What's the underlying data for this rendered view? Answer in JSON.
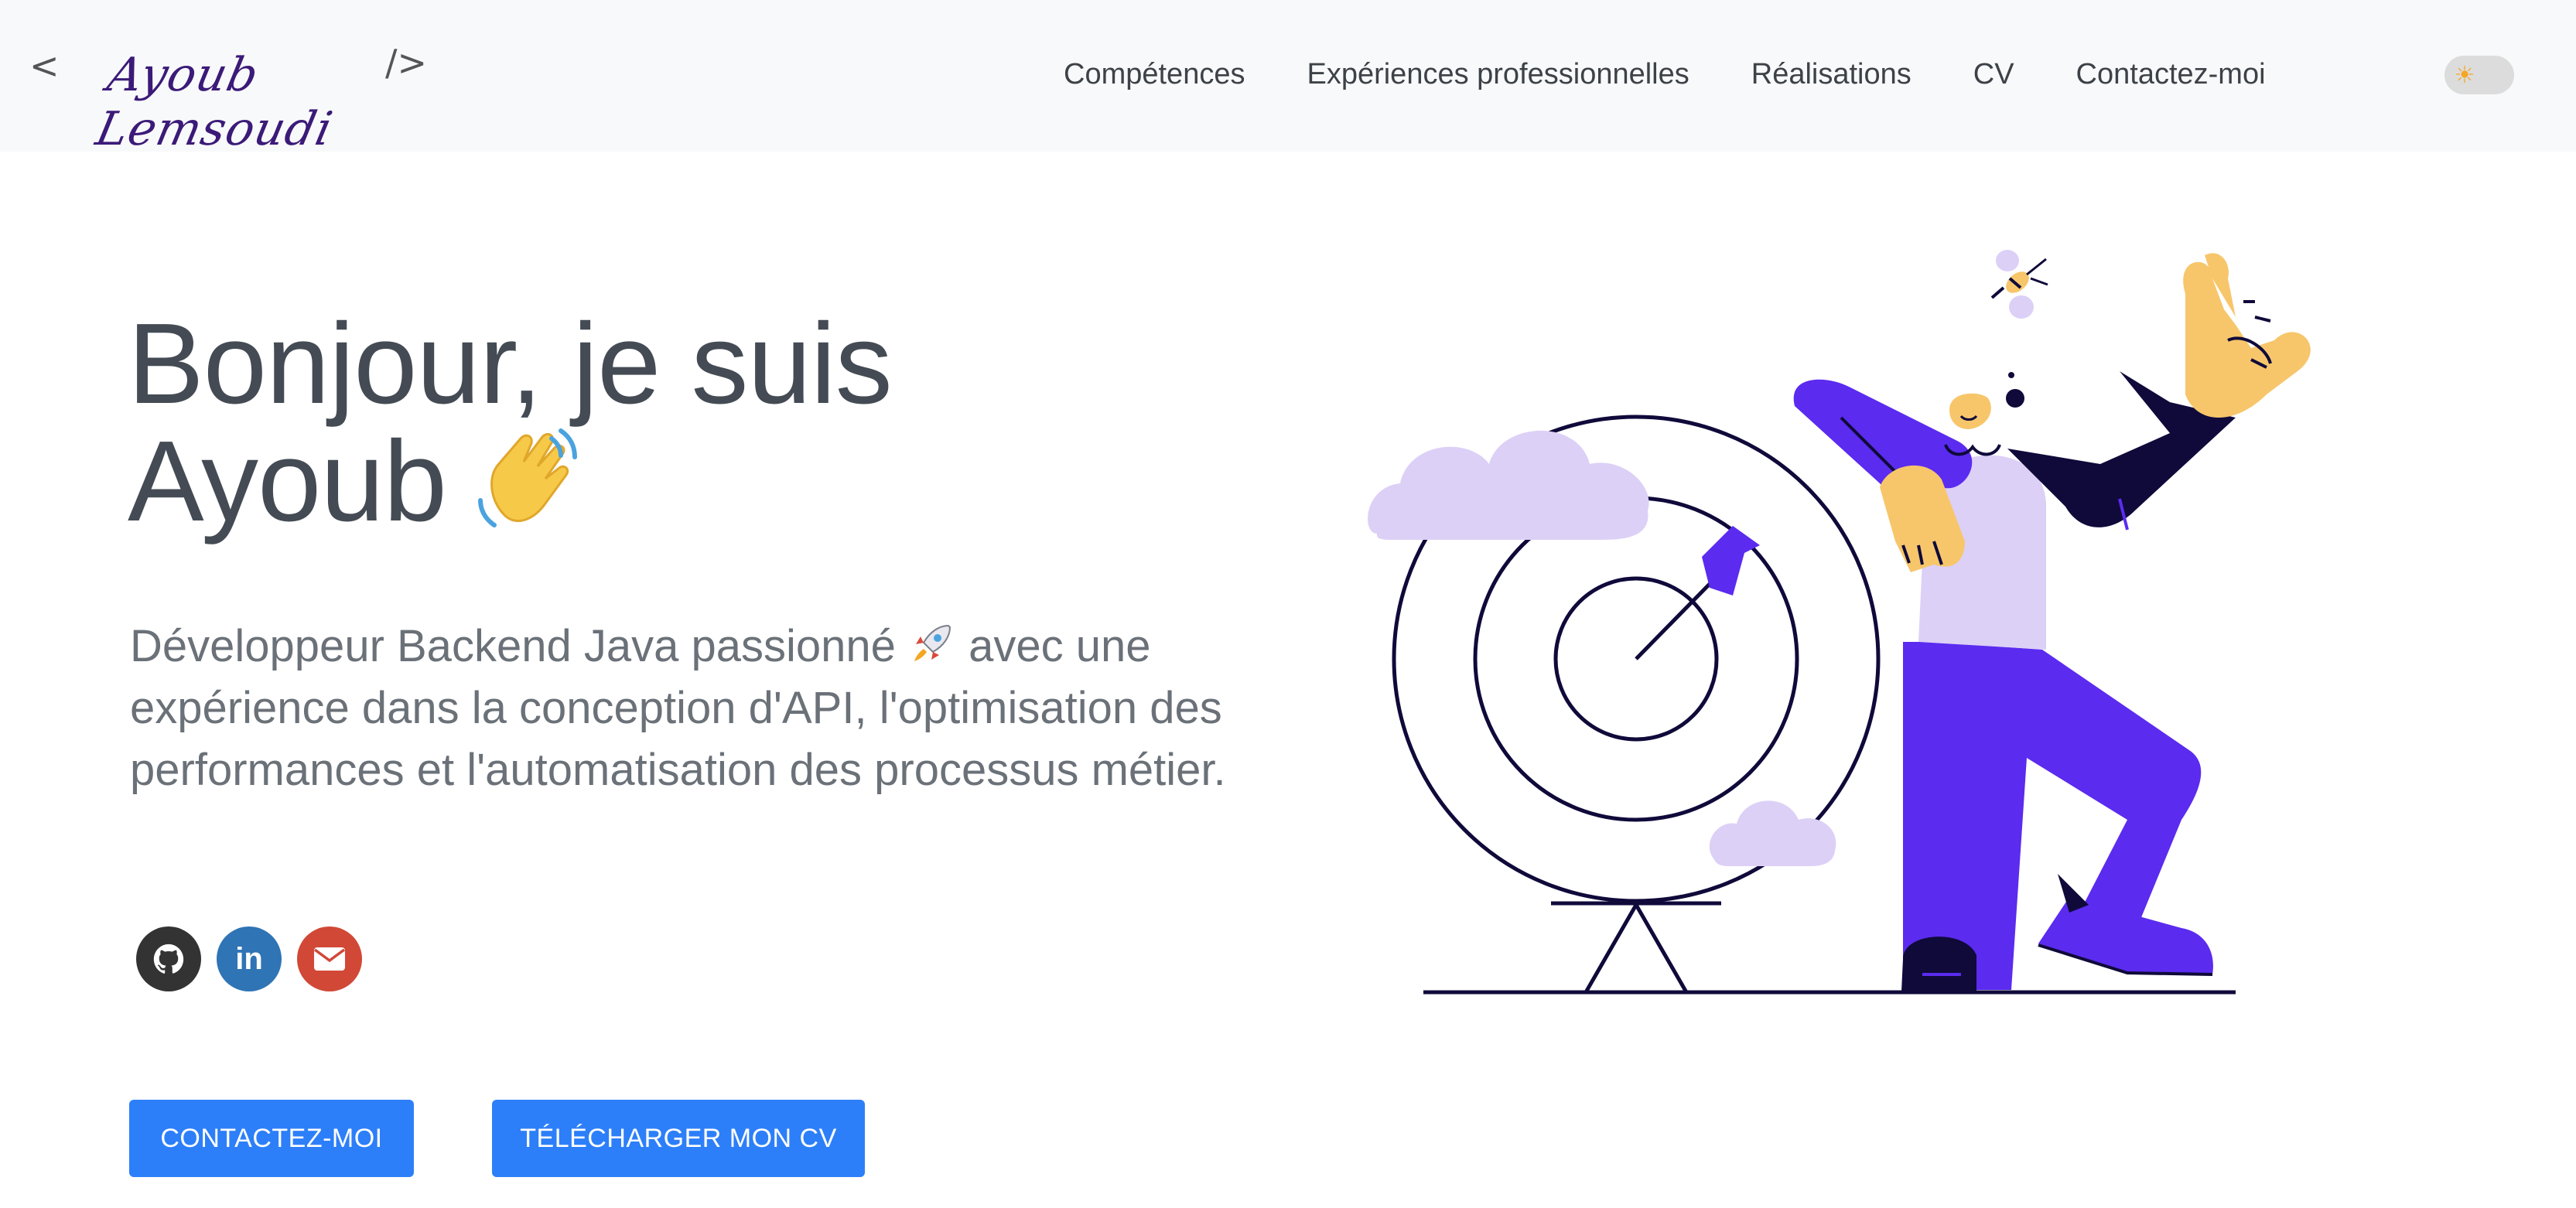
{
  "header": {
    "logo": {
      "bracket_open": "<",
      "bracket_close": "/>",
      "signature": "Ayoub Lemsoudi"
    },
    "nav": [
      {
        "label": "Compétences"
      },
      {
        "label": "Expériences professionnelles"
      },
      {
        "label": "Réalisations"
      },
      {
        "label": "CV"
      },
      {
        "label": "Contactez-moi"
      }
    ],
    "theme_toggle": {
      "icon": "sun-icon",
      "state": "light"
    }
  },
  "hero": {
    "title_line1": "Bonjour, je suis",
    "title_line2": "Ayoub",
    "wave_icon": "waving-hand-icon",
    "subtitle_part1": "Développeur Backend Java passionné",
    "rocket_icon": "rocket-icon",
    "subtitle_part2": "avec une expérience dans la conception d'API, l'optimisation des performances et l'automatisation des processus métier."
  },
  "social": [
    {
      "name": "github",
      "icon": "github-icon",
      "color": "#333333"
    },
    {
      "name": "linkedin",
      "icon": "linkedin-icon",
      "label": "in",
      "color": "#2f74b5"
    },
    {
      "name": "email",
      "icon": "mail-icon",
      "color": "#d14836"
    }
  ],
  "buttons": {
    "contact": "CONTACTEZ-MOI",
    "download_cv": "TÉLÉCHARGER MON CV"
  },
  "colors": {
    "accent": "#2d7ff9",
    "purple": "#5b2bef",
    "lavender": "#dcd0f7",
    "skin": "#f7c66b",
    "navy": "#0f0a3a"
  }
}
